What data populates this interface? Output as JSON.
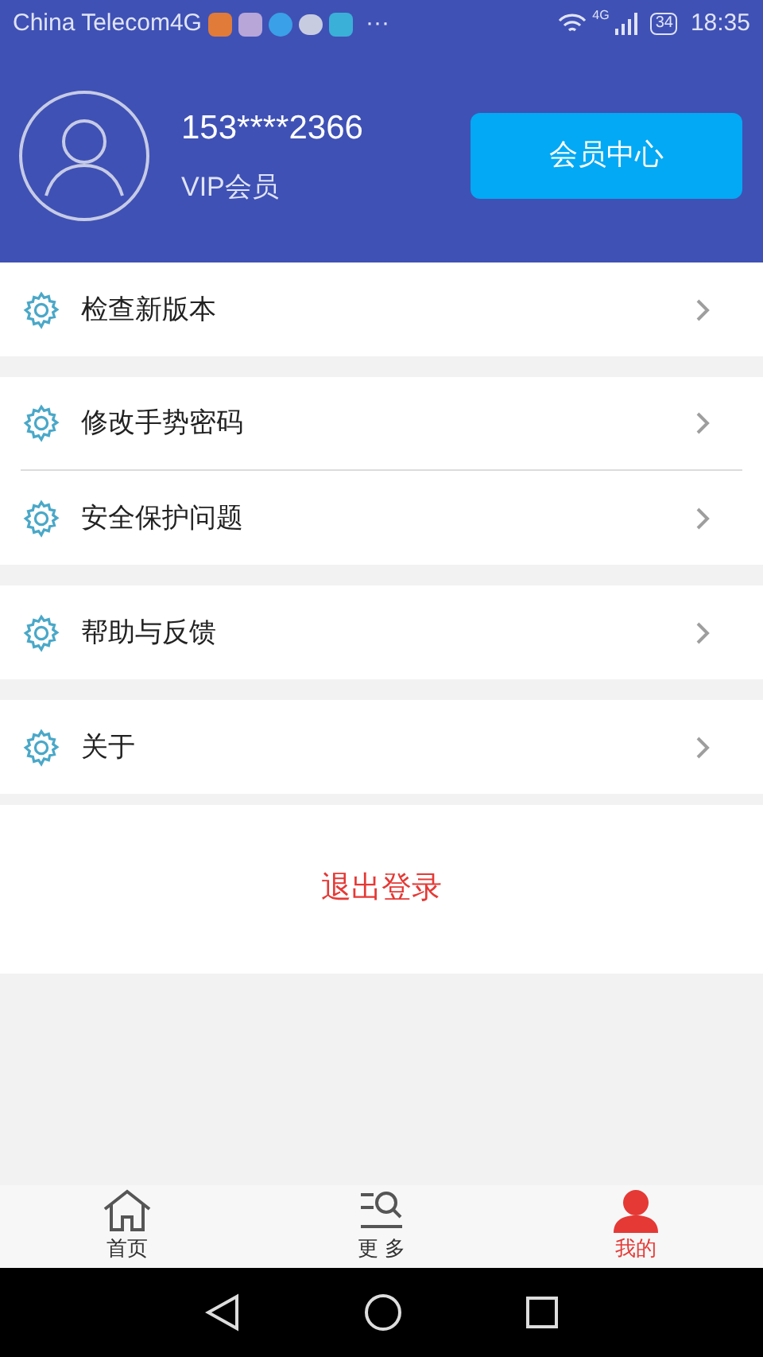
{
  "status_bar": {
    "carrier": "China Telecom4G",
    "more": "···",
    "network": "4G",
    "battery": "34",
    "time": "18:35"
  },
  "profile": {
    "phone": "153****2366",
    "membership": "VIP会员",
    "button": "会员中心"
  },
  "menu_groups": [
    {
      "items": [
        {
          "label": "检查新版本"
        }
      ]
    },
    {
      "items": [
        {
          "label": "修改手势密码"
        },
        {
          "label": "安全保护问题"
        }
      ]
    },
    {
      "items": [
        {
          "label": "帮助与反馈"
        }
      ]
    },
    {
      "items": [
        {
          "label": "关于"
        }
      ]
    }
  ],
  "logout": "退出登录",
  "tabs": [
    {
      "label": "首页",
      "kind": "home",
      "selected": false
    },
    {
      "label": "更 多",
      "kind": "more",
      "selected": false
    },
    {
      "label": "我的",
      "kind": "me",
      "selected": true
    }
  ]
}
